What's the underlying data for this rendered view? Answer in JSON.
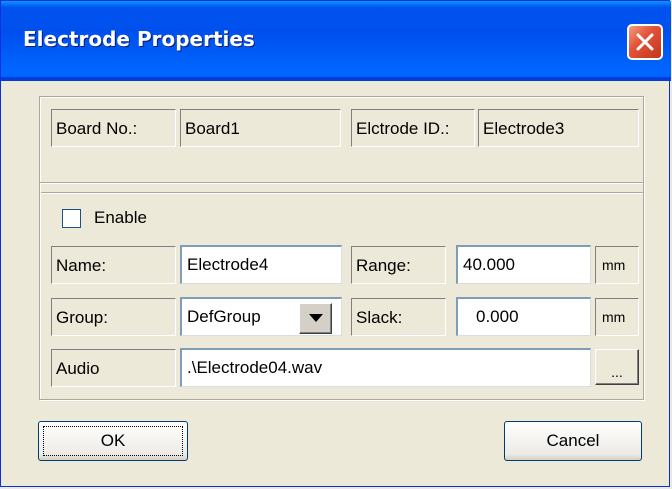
{
  "window": {
    "title": "Electrode Properties"
  },
  "board_group": {
    "board_label": "Board No.:",
    "board_value": "Board1",
    "electrode_label": "Elctrode ID.:",
    "electrode_value": "Electrode3"
  },
  "form": {
    "enable_label": "Enable",
    "enable_checked": false,
    "name_label": "Name:",
    "name_value": "Electrode4",
    "range_label": "Range:",
    "range_value": "40.000",
    "range_unit": "mm",
    "group_label": "Group:",
    "group_value": "DefGroup",
    "slack_label": "Slack:",
    "slack_value": "0.000",
    "slack_unit": "mm",
    "audio_label": "Audio",
    "audio_value": ".\\Electrode04.wav",
    "browse_label": "..."
  },
  "buttons": {
    "ok_label": "OK",
    "cancel_label": "Cancel"
  },
  "colors": {
    "titlebar": "#0053ee",
    "close": "#e3553a",
    "dialog_bg": "#ece9d8"
  },
  "icons": {
    "close": "close-icon",
    "combo_arrow": "chevron-down-icon"
  }
}
